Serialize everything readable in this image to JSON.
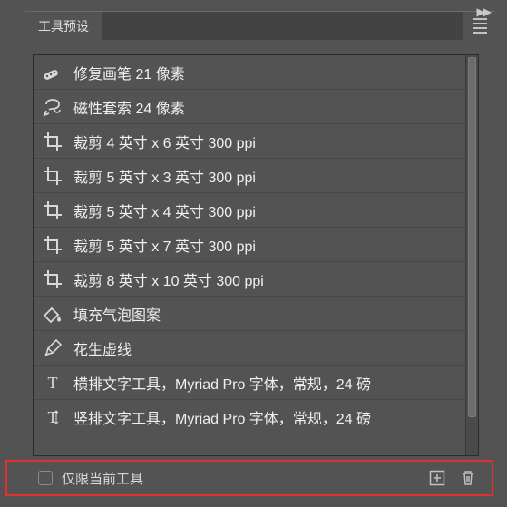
{
  "header": {
    "tab_title": "工具预设"
  },
  "presets": [
    {
      "icon": "healing-brush-icon",
      "label": "修复画笔 21 像素"
    },
    {
      "icon": "magnetic-lasso-icon",
      "label": "磁性套索 24 像素"
    },
    {
      "icon": "crop-icon",
      "label": "裁剪 4 英寸 x 6 英寸 300 ppi"
    },
    {
      "icon": "crop-icon",
      "label": "裁剪 5 英寸 x 3 英寸 300 ppi"
    },
    {
      "icon": "crop-icon",
      "label": "裁剪 5 英寸 x 4 英寸 300 ppi"
    },
    {
      "icon": "crop-icon",
      "label": "裁剪 5 英寸 x 7 英寸 300 ppi"
    },
    {
      "icon": "crop-icon",
      "label": "裁剪 8 英寸 x 10 英寸 300 ppi"
    },
    {
      "icon": "fill-icon",
      "label": "填充气泡图案"
    },
    {
      "icon": "pen-icon",
      "label": "花生虚线"
    },
    {
      "icon": "horizontal-type-icon",
      "label": "横排文字工具，Myriad Pro 字体，常规，24 磅"
    },
    {
      "icon": "vertical-type-icon",
      "label": "竖排文字工具，Myriad Pro 字体，常规，24 磅"
    }
  ],
  "footer": {
    "checkbox_label": "仅限当前工具"
  },
  "colors": {
    "panel": "#535353",
    "highlight": "#e03030",
    "text": "#f0f0f0"
  }
}
